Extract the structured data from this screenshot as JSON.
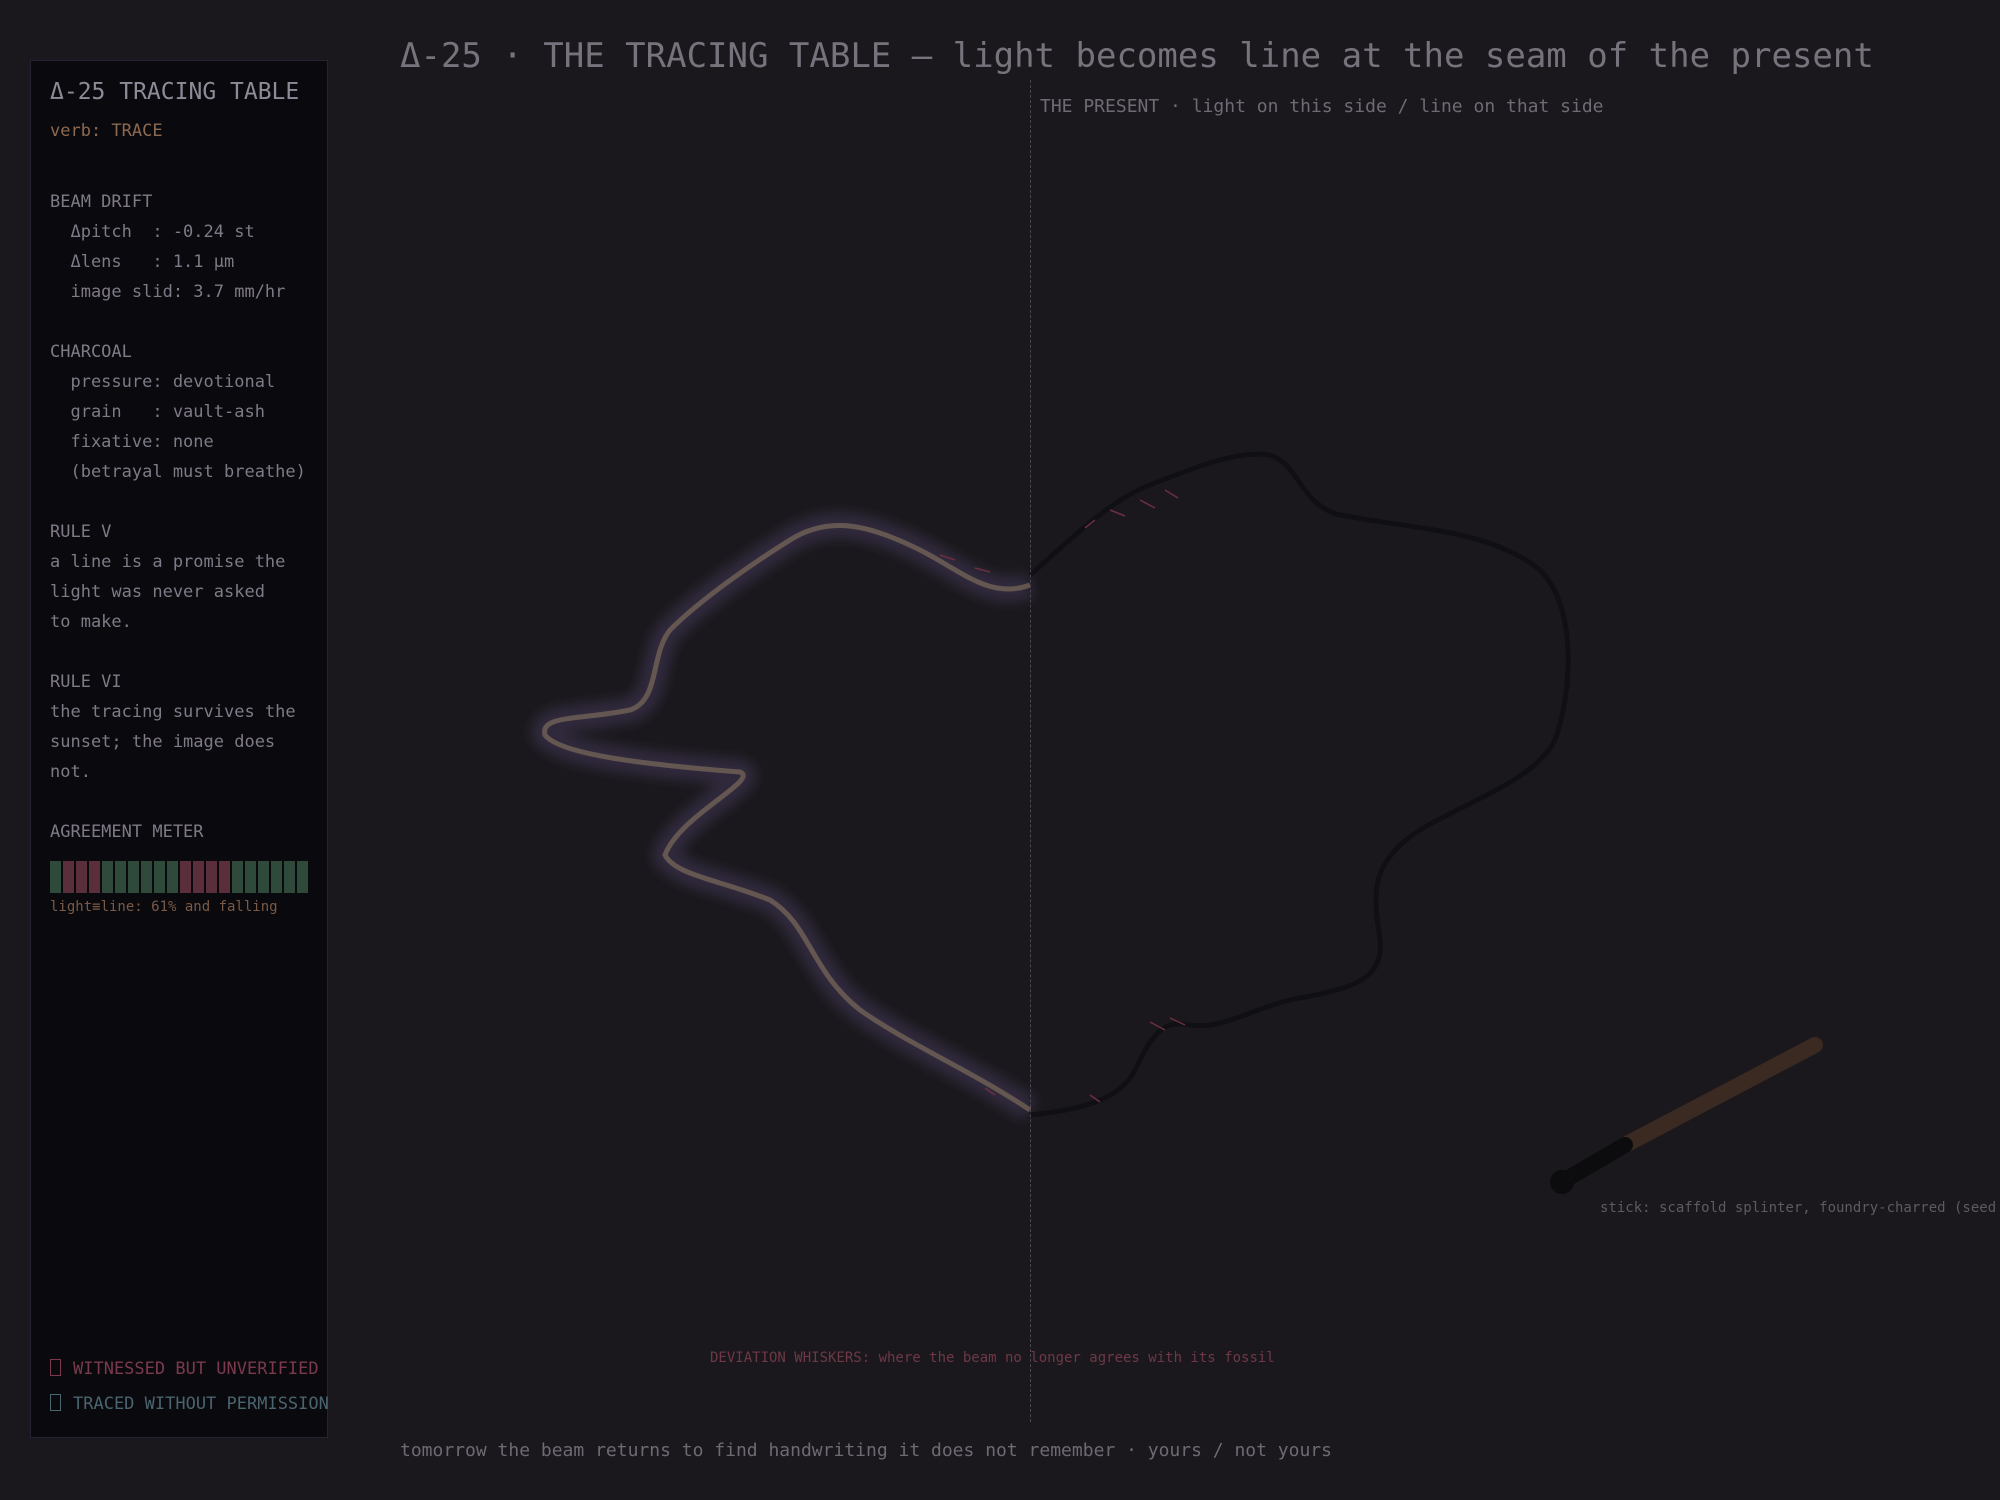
{
  "panel": {
    "title": "Δ-25 TRACING TABLE",
    "verb": "verb: TRACE",
    "beam_drift": {
      "heading": "BEAM DRIFT",
      "lines": [
        "  Δpitch  : -0.24 st",
        "  Δlens   : 1.1 µm",
        "  image slid: 3.7 mm/hr"
      ]
    },
    "charcoal": {
      "heading": "CHARCOAL",
      "lines": [
        "  pressure: devotional",
        "  grain   : vault-ash",
        "  fixative: none",
        "  (betrayal must breathe)"
      ]
    },
    "rule_v": {
      "heading": "RULE V",
      "lines": [
        "a line is a promise the",
        "light was never asked",
        "to make."
      ]
    },
    "rule_vi": {
      "heading": "RULE VI",
      "lines": [
        "the tracing survives the",
        "sunset; the image does",
        "not."
      ]
    },
    "meter": {
      "heading": "AGREEMENT METER",
      "caption": "light≡line: 61% and falling",
      "segments": [
        "green",
        "red",
        "red",
        "red",
        "green",
        "green",
        "green",
        "green",
        "green",
        "green",
        "red",
        "red",
        "red",
        "red",
        "green",
        "green",
        "green",
        "green",
        "green",
        "green"
      ]
    },
    "stamps": {
      "witnessed": "WITNESSED BUT UNVERIFIED",
      "traced": "TRACED WITHOUT PERMISSION"
    }
  },
  "title": "Δ-25 · THE TRACING TABLE — light becomes line at the seam of the present",
  "seam_label": "THE PRESENT · light on this side / line on that side",
  "deviation_label": "DEVIATION WHISKERS: where the beam no longer agrees with its fossil",
  "stick_label": "stick: scaffold splinter, foundry-charred (seed",
  "footer": "tomorrow the beam returns to find handwriting it does not remember · yours / not yours",
  "colors": {
    "background": "#1a181c",
    "panel": "#0a090d",
    "meter_green": "#2f4a3a",
    "meter_red": "#5a2e3a",
    "verb": "#8c6a52",
    "witnessed": "#7a3a4c",
    "traced": "#4a6470",
    "deviation": "#6e3846"
  }
}
